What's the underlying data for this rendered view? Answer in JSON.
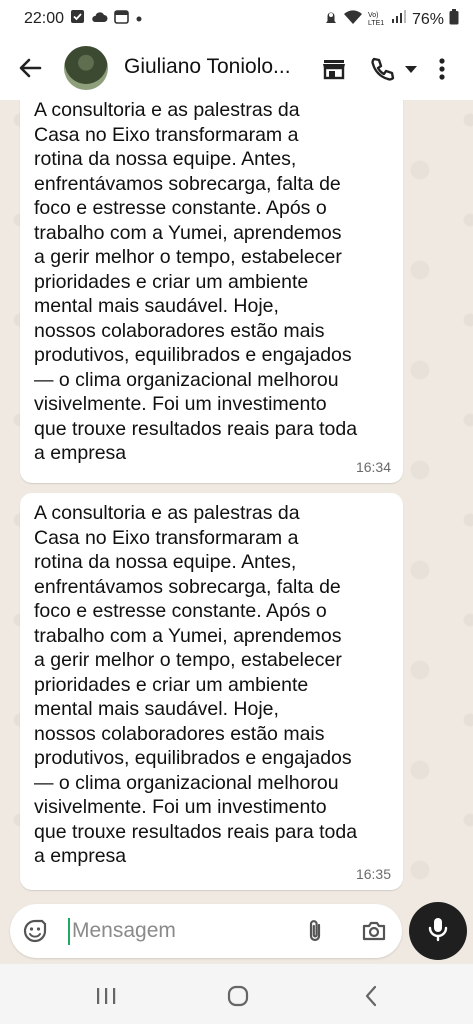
{
  "status_bar": {
    "time": "22:00",
    "battery": "76%",
    "network_label": "Vo) LTE1"
  },
  "header": {
    "contact_name": "Giuliano Toniolo..."
  },
  "messages": [
    {
      "text": "A consultoria e as palestras da\nCasa no Eixo transformaram a\nrotina da nossa equipe. Antes,\nenfrentávamos sobrecarga, falta de\nfoco e estresse constante. Após o\ntrabalho com a Yumei, aprendemos\na gerir melhor o tempo, estabelecer\nprioridades e criar um ambiente\nmental mais saudável. Hoje,\nnossos colaboradores estão mais\nprodutivos, equilibrados e engajados\n— o clima organizacional melhorou\nvisivelmente. Foi um investimento\nque trouxe resultados reais para toda\na empresa",
      "time": "16:34"
    },
    {
      "text": "A consultoria e as palestras da\nCasa no Eixo transformaram a\nrotina da nossa equipe. Antes,\nenfrentávamos sobrecarga, falta de\nfoco e estresse constante. Após o\ntrabalho com a Yumei, aprendemos\na gerir melhor o tempo, estabelecer\nprioridades e criar um ambiente\nmental mais saudável. Hoje,\nnossos colaboradores estão mais\nprodutivos, equilibrados e engajados\n— o clima organizacional melhorou\nvisivelmente. Foi um investimento\nque trouxe resultados reais para toda\na empresa",
      "time": "16:35"
    }
  ],
  "composer": {
    "placeholder": "Mensagem"
  },
  "colors": {
    "chat_background": "#efe9e1",
    "bubble": "#ffffff",
    "caret": "#1faa62",
    "mic_button": "#1f1f1f"
  },
  "icons": [
    "back-arrow-icon",
    "store-icon",
    "phone-icon",
    "dropdown-icon",
    "more-vert-icon",
    "sticker-icon",
    "paperclip-icon",
    "camera-icon",
    "mic-icon",
    "recents-icon",
    "home-icon",
    "nav-back-icon"
  ]
}
